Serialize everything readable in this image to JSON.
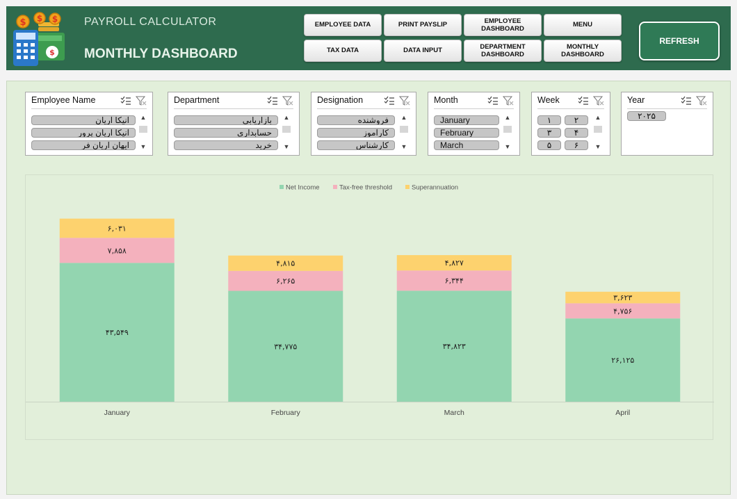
{
  "header": {
    "app_title": "PAYROLL CALCULATOR",
    "page_title": "MONTHLY DASHBOARD",
    "nav_buttons": [
      {
        "label": "EMPLOYEE DATA"
      },
      {
        "label": "PRINT PAYSLIP"
      },
      {
        "label": "EMPLOYEE\nDASHBOARD"
      },
      {
        "label": "MENU"
      },
      {
        "label": "TAX DATA"
      },
      {
        "label": "DATA INPUT"
      },
      {
        "label": "DEPARTMENT\nDASHBOARD"
      },
      {
        "label": "MONTHLY\nDASHBOARD"
      }
    ],
    "refresh_label": "REFRESH"
  },
  "icons": {
    "multiselect": "multi-select-icon",
    "clear_filter": "clear-filter-icon",
    "scroll_up": "chevron-up-icon",
    "scroll_down": "chevron-down-icon",
    "logo": "payroll-calculator-coins-icon"
  },
  "slicers": [
    {
      "title": "Employee Name",
      "items": [
        "آنیکا آریان",
        "آنیکا آریان پرور",
        "ایهان آریان فر"
      ]
    },
    {
      "title": "Department",
      "items": [
        "بازاریابی",
        "حسابداری",
        "خرید"
      ]
    },
    {
      "title": "Designation",
      "items": [
        "فروشنده",
        "کارآموز",
        "کارشناس"
      ]
    },
    {
      "title": "Month",
      "items": [
        "January",
        "February",
        "March"
      ]
    },
    {
      "title": "Week",
      "items": [
        "۱",
        "۲",
        "۳",
        "۴",
        "۵",
        "۶"
      ]
    },
    {
      "title": "Year",
      "items": [
        "۲۰۲۵"
      ]
    }
  ],
  "colors": {
    "header_bg": "#2e6b4e",
    "main_bg": "#e2efda",
    "net_income": "#93d5b0",
    "tax_free_threshold": "#f4b1bd",
    "superannuation": "#fdd26e",
    "refresh_bg": "#2f7a56"
  },
  "chart_data": {
    "type": "bar",
    "stacked": true,
    "categories": [
      "January",
      "February",
      "March",
      "April"
    ],
    "series": [
      {
        "name": "Net Income",
        "values": [
          43549,
          34775,
          34823,
          26125
        ],
        "labels": [
          "۴۳,۵۴۹",
          "۳۴,۷۷۵",
          "۳۴,۸۲۳",
          "۲۶,۱۲۵"
        ],
        "color": "#93d5b0"
      },
      {
        "name": "Tax-free threshold",
        "values": [
          7858,
          6265,
          6344,
          4756
        ],
        "labels": [
          "۷,۸۵۸",
          "۶,۲۶۵",
          "۶,۳۴۴",
          "۴,۷۵۶"
        ],
        "color": "#f4b1bd"
      },
      {
        "name": "Superannuation",
        "values": [
          6031,
          4815,
          4827,
          3623
        ],
        "labels": [
          "۶,۰۳۱",
          "۴,۸۱۵",
          "۴,۸۲۷",
          "۳,۶۲۳"
        ],
        "color": "#fdd26e"
      }
    ],
    "legend_position": "top",
    "grid": false,
    "ylim": [
      0,
      58000
    ]
  }
}
